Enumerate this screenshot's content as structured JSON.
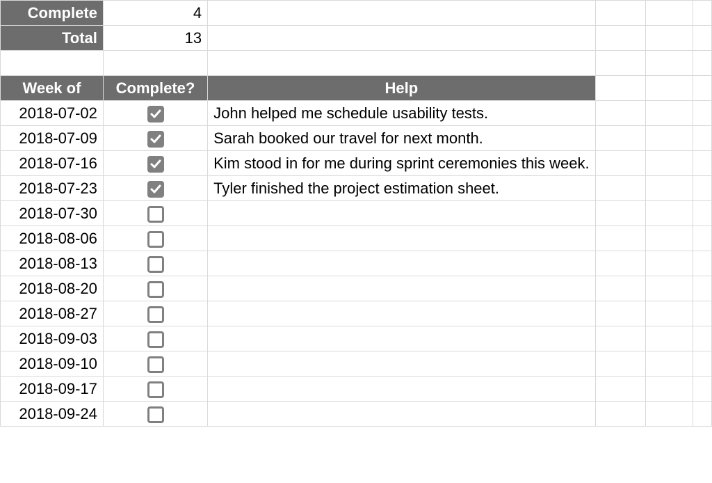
{
  "summary": {
    "complete_label": "Complete",
    "complete_value": "4",
    "total_label": "Total",
    "total_value": "13"
  },
  "headers": {
    "week": "Week of",
    "complete": "Complete?",
    "help": "Help"
  },
  "rows": [
    {
      "week": "2018-07-02",
      "done": true,
      "help": "John helped me schedule usability tests."
    },
    {
      "week": "2018-07-09",
      "done": true,
      "help": "Sarah booked our travel for next month."
    },
    {
      "week": "2018-07-16",
      "done": true,
      "help": "Kim stood in for me during sprint ceremonies this week."
    },
    {
      "week": "2018-07-23",
      "done": true,
      "help": "Tyler finished the project estimation sheet."
    },
    {
      "week": "2018-07-30",
      "done": false,
      "help": ""
    },
    {
      "week": "2018-08-06",
      "done": false,
      "help": ""
    },
    {
      "week": "2018-08-13",
      "done": false,
      "help": ""
    },
    {
      "week": "2018-08-20",
      "done": false,
      "help": ""
    },
    {
      "week": "2018-08-27",
      "done": false,
      "help": ""
    },
    {
      "week": "2018-09-03",
      "done": false,
      "help": ""
    },
    {
      "week": "2018-09-10",
      "done": false,
      "help": ""
    },
    {
      "week": "2018-09-17",
      "done": false,
      "help": ""
    },
    {
      "week": "2018-09-24",
      "done": false,
      "help": ""
    }
  ]
}
